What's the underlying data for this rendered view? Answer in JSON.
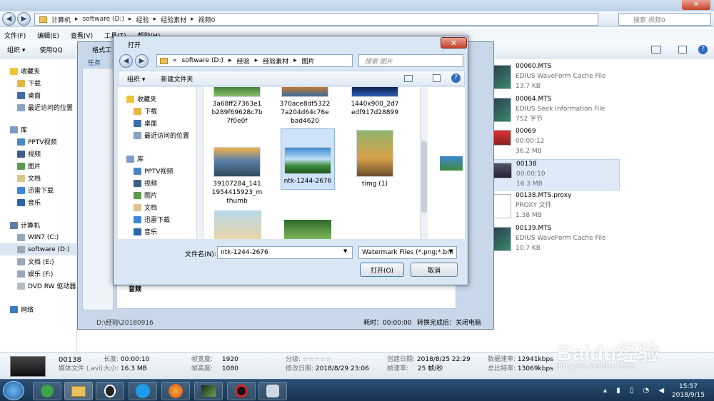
{
  "main": {
    "breadcrumb": [
      "计算机",
      "software (D:)",
      "经验",
      "经验素材",
      "视频0"
    ],
    "search_placeholder": "搜索 视频0",
    "menu": [
      "文件(F)",
      "编辑(E)",
      "查看(V)",
      "工具(T)",
      "帮助(H)"
    ],
    "toolbar": {
      "organize": "组织 ▾",
      "use_qq": "使用QQ"
    },
    "nav": {
      "favorites": "收藏夹",
      "download": "下载",
      "desktop": "桌面",
      "recent": "最近访问的位置",
      "library": "库",
      "pptv": "PPTV视频",
      "video": "视频",
      "pictures": "图片",
      "documents": "文档",
      "xunlei": "迅雷下载",
      "music": "音乐",
      "computer": "计算机",
      "win7": "WIN7 (C:)",
      "software": "software (D:)",
      "docs_e": "文档 (E:)",
      "ent": "娱乐 (F:)",
      "dvd": "DVD RW 驱动器",
      "network": "网络"
    },
    "files": [
      {
        "name": "00060.MTS",
        "line2": "EDIUS WaveForm Cache File",
        "line3": "13.7 KB",
        "icon": "edius-icon"
      },
      {
        "name": "00064.MTS",
        "line2": "EDIUS Seek Information File",
        "line3": "752 字节",
        "icon": "edius-icon"
      },
      {
        "name": "00069",
        "line2": "00:00:12",
        "line3": "36.2 MB",
        "icon": "video-thumb"
      },
      {
        "name": "00138",
        "line2": "00:00:10",
        "line3": "16.3 MB",
        "icon": "video-thumb"
      },
      {
        "name": "00138.MTS.proxy",
        "line2": "PROXY 文件",
        "line3": "1.38 MB",
        "icon": "file-icon"
      },
      {
        "name": "00139.MTS",
        "line2": "EDIUS WaveForm Cache File",
        "line3": "10.7 KB",
        "icon": "edius-icon"
      }
    ]
  },
  "details": {
    "name": "00138",
    "type": "媒体文件 (.avi)",
    "length_label": "长度:",
    "length": "00:00:10",
    "size_label": "大小:",
    "size": "16.3 MB",
    "width_label": "帧宽度:",
    "width": "1920",
    "height_label": "帧高度:",
    "height": "1080",
    "rating_label": "分级:",
    "rating": "☆☆☆☆☆",
    "modified_label": "修改日期:",
    "modified": "2018/8/29 23:06",
    "created_label": "创建日期:",
    "created": "2018/8/25 22:29",
    "fps_label": "帧速率:",
    "fps": "25 帧/秒",
    "datarate_label": "数据速率:",
    "datarate": "12941kbps",
    "bitrate_label": "总比特率:",
    "bitrate": "13069kbps"
  },
  "midwin": {
    "title": "格式工",
    "tab": "任务",
    "status_path": "D:\\经验\\20180916",
    "section": "音频",
    "dur_label": "耗时：00:00:00",
    "done_label": "转换完成后：关闭电脑"
  },
  "dialog": {
    "title": "打开",
    "breadcrumb": [
      "software (D:)",
      "经验",
      "经验素材",
      "图片"
    ],
    "search_placeholder": "搜索 图片",
    "organize": "组织 ▾",
    "new_folder": "新建文件夹",
    "nav": {
      "favorites": "收藏夹",
      "download": "下载",
      "desktop": "桌面",
      "recent": "最近访问的位置",
      "library": "库",
      "pptv": "PPTV视频",
      "video": "视频",
      "pictures": "图片",
      "documents": "文档",
      "xunlei": "迅雷下载",
      "music": "音乐"
    },
    "files": [
      {
        "name": "3a68ff27363e1b289f69628c7b7f0e0f"
      },
      {
        "name": "370ace8df53227a204d64c76ebad4620"
      },
      {
        "name": "1440x900_2d7edf917d28899"
      },
      {
        "name": "39107284_1411954415923_mthumb"
      },
      {
        "name": "ntk-1244-2676"
      },
      {
        "name": "timg (1)"
      }
    ],
    "filename_label": "文件名(N):",
    "filename": "ntk-1244-2676",
    "filter": "Watermark Files (*.png;*.bm",
    "open": "打开(O)",
    "cancel": "取消"
  },
  "taskbar": {
    "time": "15:57",
    "date": "2018/9/15"
  },
  "watermark": {
    "brand": "Baidu经验",
    "url": "jingyan.baidu.com"
  }
}
